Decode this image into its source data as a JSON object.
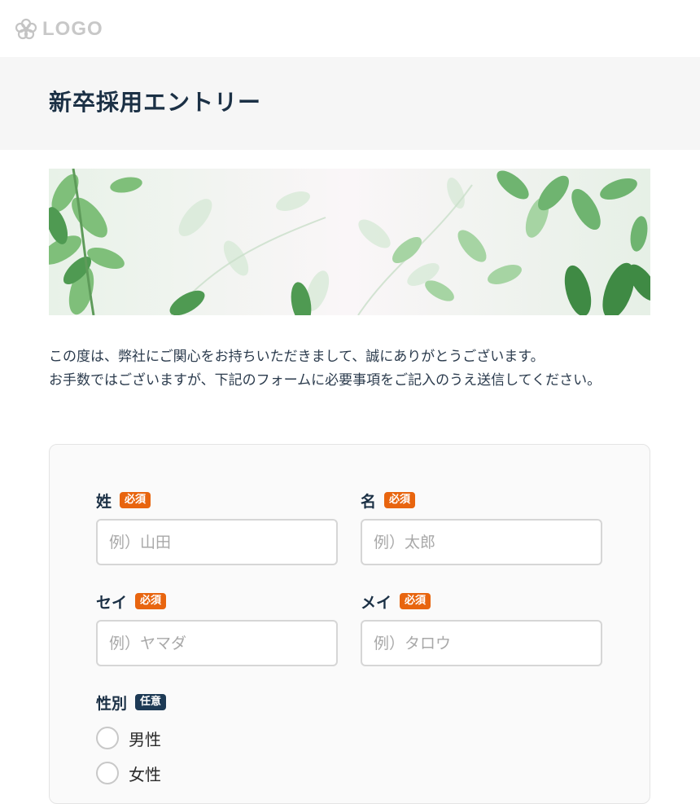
{
  "logo": {
    "text": "LOGO",
    "icon": "flower-icon"
  },
  "page": {
    "title": "新卒採用エントリー"
  },
  "intro": {
    "line1": "この度は、弊社にご関心をお持ちいただきまして、誠にありがとうございます。",
    "line2": "お手数ではございますが、下記のフォームに必要事項をご記入のうえ送信してください。"
  },
  "form": {
    "fields": {
      "last_name": {
        "label": "姓",
        "badge": "必須",
        "placeholder": "例）山田"
      },
      "first_name": {
        "label": "名",
        "badge": "必須",
        "placeholder": "例）太郎"
      },
      "last_name_kana": {
        "label": "セイ",
        "badge": "必須",
        "placeholder": "例）ヤマダ"
      },
      "first_name_kana": {
        "label": "メイ",
        "badge": "必須",
        "placeholder": "例）タロウ"
      }
    },
    "gender": {
      "label": "性別",
      "badge": "任意",
      "options": [
        "男性",
        "女性"
      ]
    }
  },
  "colors": {
    "required_badge": "#e8650f",
    "optional_badge": "#1d3a55",
    "title_text": "#1b3045",
    "title_band": "#f6f6f6",
    "card_bg": "#fafafa"
  }
}
